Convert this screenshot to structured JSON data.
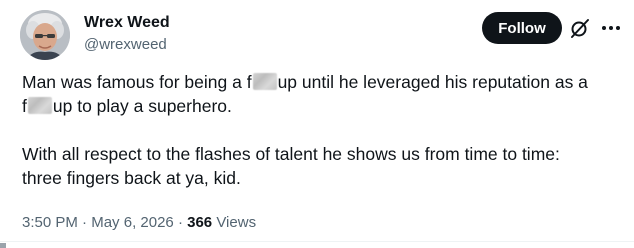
{
  "author": {
    "name": "Wrex Weed",
    "handle": "@wrexweed"
  },
  "header": {
    "follow_label": "Follow",
    "grok_icon": "grok-slash-circle-icon",
    "more_icon": "more-dots-icon"
  },
  "tweet": {
    "line1_a": "Man was famous for being a f",
    "line1_b": "up until he leveraged his reputation as a",
    "line2_a": "f",
    "line2_b": "up to play a superhero.",
    "line3": "With all respect to the flashes of talent he shows us from time to time:",
    "line4": "three fingers back at ya, kid."
  },
  "meta": {
    "time": "3:50 PM",
    "sep1": " · ",
    "date": "May 6, 2026",
    "sep2": " · ",
    "views_count": "366",
    "views_label": " Views"
  },
  "colors": {
    "text_primary": "#0f1419",
    "text_secondary": "#536471",
    "follow_bg": "#0f1419",
    "follow_text": "#ffffff",
    "divider": "#eff3f4"
  }
}
